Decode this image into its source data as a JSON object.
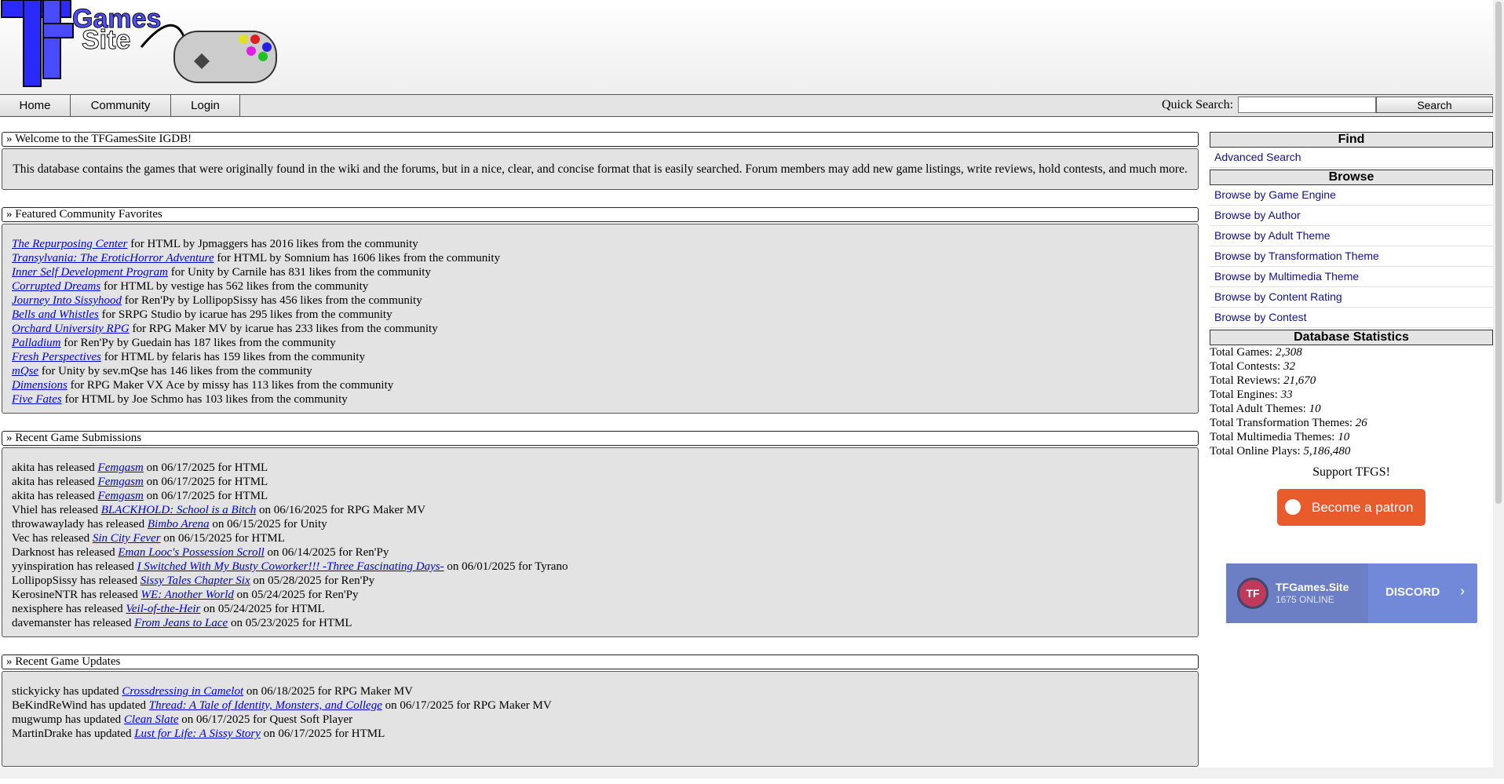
{
  "header": {
    "logo_text": "TFGamesSite"
  },
  "nav": {
    "items": [
      "Home",
      "Community",
      "Login"
    ],
    "quick_search_label": "Quick Search:",
    "search_value": "",
    "search_button": "Search"
  },
  "welcome": {
    "title": "» Welcome to the TFGamesSite IGDB!",
    "text": "This database contains the games that were originally found in the wiki and the forums, but in a nice, clear, and concise format that is easily searched. Forum members may add new game listings, write reviews, hold contests, and much more."
  },
  "favorites": {
    "title": "» Featured Community Favorites",
    "items": [
      {
        "game": "The Repurposing Center",
        "engine": "HTML",
        "author": "Jpmaggers",
        "likes": "2016"
      },
      {
        "game": "Transylvania: The EroticHorror Adventure",
        "engine": "HTML",
        "author": "Somnium",
        "likes": "1606"
      },
      {
        "game": "Inner Self Development Program",
        "engine": "Unity",
        "author": "Carnile",
        "likes": "831"
      },
      {
        "game": "Corrupted Dreams",
        "engine": "HTML",
        "author": "vestige",
        "likes": "562"
      },
      {
        "game": "Journey Into Sissyhood",
        "engine": "Ren'Py",
        "author": "LollipopSissy",
        "likes": "456"
      },
      {
        "game": "Bells and Whistles",
        "engine": "SRPG Studio",
        "author": "icarue",
        "likes": "295"
      },
      {
        "game": "Orchard University RPG",
        "engine": "RPG Maker MV",
        "author": "icarue",
        "likes": "233"
      },
      {
        "game": "Palladium",
        "engine": "Ren'Py",
        "author": "Guedain",
        "likes": "187"
      },
      {
        "game": "Fresh Perspectives",
        "engine": "HTML",
        "author": "felaris",
        "likes": "159"
      },
      {
        "game": "mQse",
        "engine": "Unity",
        "author": "sev.mQse",
        "likes": "146"
      },
      {
        "game": "Dimensions",
        "engine": "RPG Maker VX Ace",
        "author": "missy",
        "likes": "113"
      },
      {
        "game": "Five Fates",
        "engine": "HTML",
        "author": "Joe Schmo",
        "likes": "103"
      }
    ]
  },
  "submissions": {
    "title": "» Recent Game Submissions",
    "items": [
      {
        "user": "akita",
        "game": "Femgasm",
        "date": "06/17/2025",
        "engine": "HTML"
      },
      {
        "user": "akita",
        "game": "Femgasm",
        "date": "06/17/2025",
        "engine": "HTML"
      },
      {
        "user": "akita",
        "game": "Femgasm",
        "date": "06/17/2025",
        "engine": "HTML"
      },
      {
        "user": "Vhiel",
        "game": "BLACKHOLD: School is a Bitch",
        "date": "06/16/2025",
        "engine": "RPG Maker MV"
      },
      {
        "user": "throwawaylady",
        "game": "Bimbo Arena",
        "date": "06/15/2025",
        "engine": "Unity"
      },
      {
        "user": "Vec",
        "game": "Sin City Fever",
        "date": "06/15/2025",
        "engine": "HTML"
      },
      {
        "user": "Darknost",
        "game": "Eman Looc's Possession Scroll",
        "date": "06/14/2025",
        "engine": "Ren'Py"
      },
      {
        "user": "yyinspiration",
        "game": "I Switched With My Busty Coworker!!! -Three Fascinating Days-",
        "date": "06/01/2025",
        "engine": "Tyrano"
      },
      {
        "user": "LollipopSissy",
        "game": "Sissy Tales Chapter Six",
        "date": "05/28/2025",
        "engine": "Ren'Py"
      },
      {
        "user": "KerosineNTR",
        "game": "WE: Another World",
        "date": "05/24/2025",
        "engine": "Ren'Py"
      },
      {
        "user": "nexisphere",
        "game": "Veil-of-the-Heir",
        "date": "05/24/2025",
        "engine": "HTML"
      },
      {
        "user": "davemanster",
        "game": "From Jeans to Lace",
        "date": "05/23/2025",
        "engine": "HTML"
      }
    ]
  },
  "updates": {
    "title": "» Recent Game Updates",
    "items": [
      {
        "user": "stickyicky",
        "game": "Crossdressing in Camelot",
        "date": "06/18/2025",
        "engine": "RPG Maker MV"
      },
      {
        "user": "BeKindReWind",
        "game": "Thread: A Tale of Identity, Monsters, and College",
        "date": "06/17/2025",
        "engine": "RPG Maker MV"
      },
      {
        "user": "mugwump",
        "game": "Clean Slate",
        "date": "06/17/2025",
        "engine": "Quest Soft Player"
      },
      {
        "user": "MartinDrake",
        "game": "Lust for Life: A Sissy Story",
        "date": "06/17/2025",
        "engine": "HTML"
      }
    ]
  },
  "sidebar": {
    "find_title": "Find",
    "advanced_search": "Advanced Search",
    "browse_title": "Browse",
    "browse_links": [
      "Browse by Game Engine",
      "Browse by Author",
      "Browse by Adult Theme",
      "Browse by Transformation Theme",
      "Browse by Multimedia Theme",
      "Browse by Content Rating",
      "Browse by Contest"
    ],
    "stats_title": "Database Statistics",
    "stats": [
      {
        "label": "Total Games:",
        "value": "2,308"
      },
      {
        "label": "Total Contests:",
        "value": "32"
      },
      {
        "label": "Total Reviews:",
        "value": "21,670"
      },
      {
        "label": "Total Engines:",
        "value": "33"
      },
      {
        "label": "Total Adult Themes:",
        "value": "10"
      },
      {
        "label": "Total Transformation Themes:",
        "value": "26"
      },
      {
        "label": "Total Multimedia Themes:",
        "value": "10"
      },
      {
        "label": "Total Online Plays:",
        "value": "5,186,480"
      }
    ],
    "support_text": "Support TFGS!",
    "patron_button": "Become a patron",
    "discord": {
      "server": "TFGames.Site",
      "online": "1675 ONLINE",
      "brand": "DISCORD",
      "avatar": "TF"
    }
  },
  "colors": {
    "link": "#0000d0",
    "panel_bg": "#e3e3e3",
    "patreon": "#e85b2a",
    "discord": "#7289da"
  }
}
